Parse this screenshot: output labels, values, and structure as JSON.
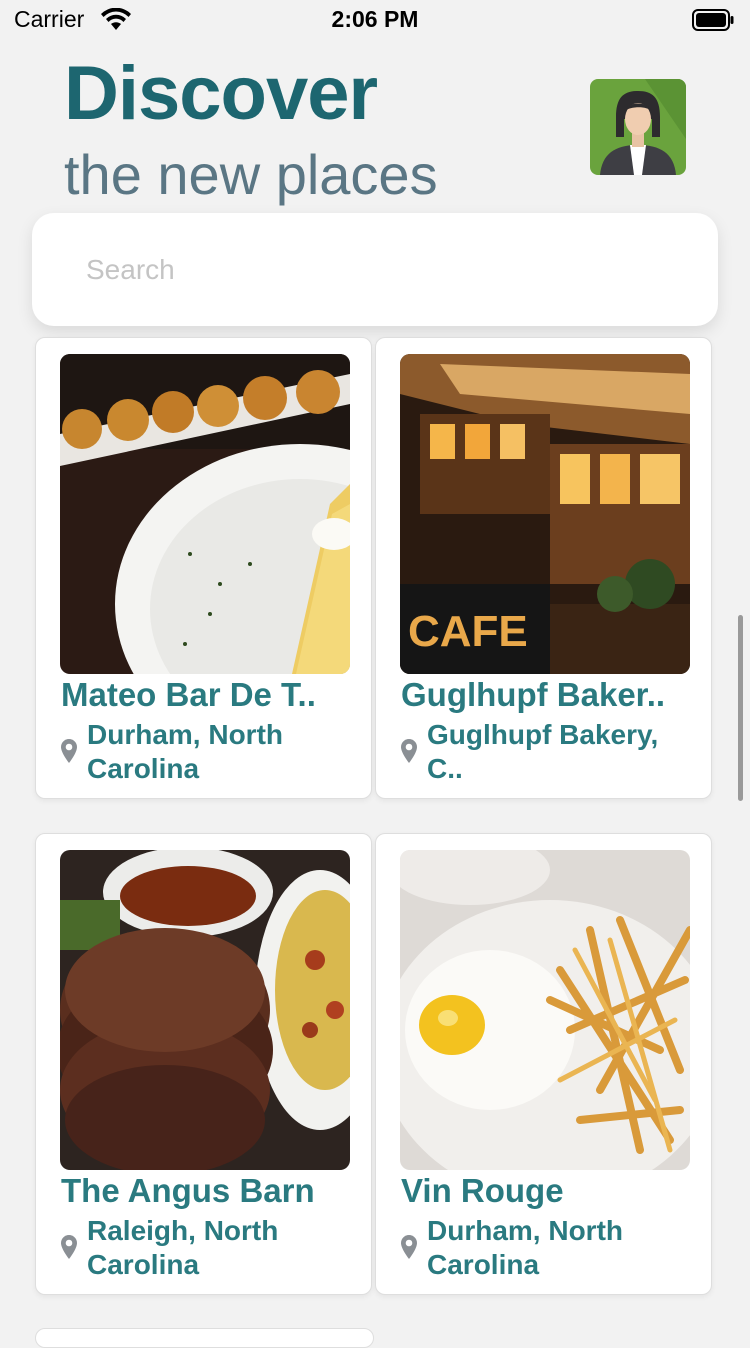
{
  "status_bar": {
    "carrier": "Carrier",
    "time": "2:06 PM",
    "wifi_icon": "wifi-icon",
    "battery_icon": "battery-icon"
  },
  "header": {
    "title": "Discover",
    "subtitle": "the new places",
    "avatar_icon": "user-avatar"
  },
  "search": {
    "placeholder": "Search",
    "value": ""
  },
  "places": [
    {
      "name": "Mateo Bar De T..",
      "location": "Durham, North Carolina",
      "location_icon": "map-pin-icon"
    },
    {
      "name": "Guglhupf Baker..",
      "location": "Guglhupf Bakery, C..",
      "location_icon": "map-pin-icon"
    },
    {
      "name": "The Angus Barn",
      "location": "Raleigh, North Carolina",
      "location_icon": "map-pin-icon"
    },
    {
      "name": "Vin Rouge",
      "location": "Durham, North Carolina",
      "location_icon": "map-pin-icon"
    }
  ],
  "photo_text": {
    "cafe_sign": "CAFE"
  },
  "colors": {
    "accent": "#1d6670",
    "subtitle": "#5a7684",
    "card_text": "#2a7a80",
    "background": "#f2f2f2"
  }
}
